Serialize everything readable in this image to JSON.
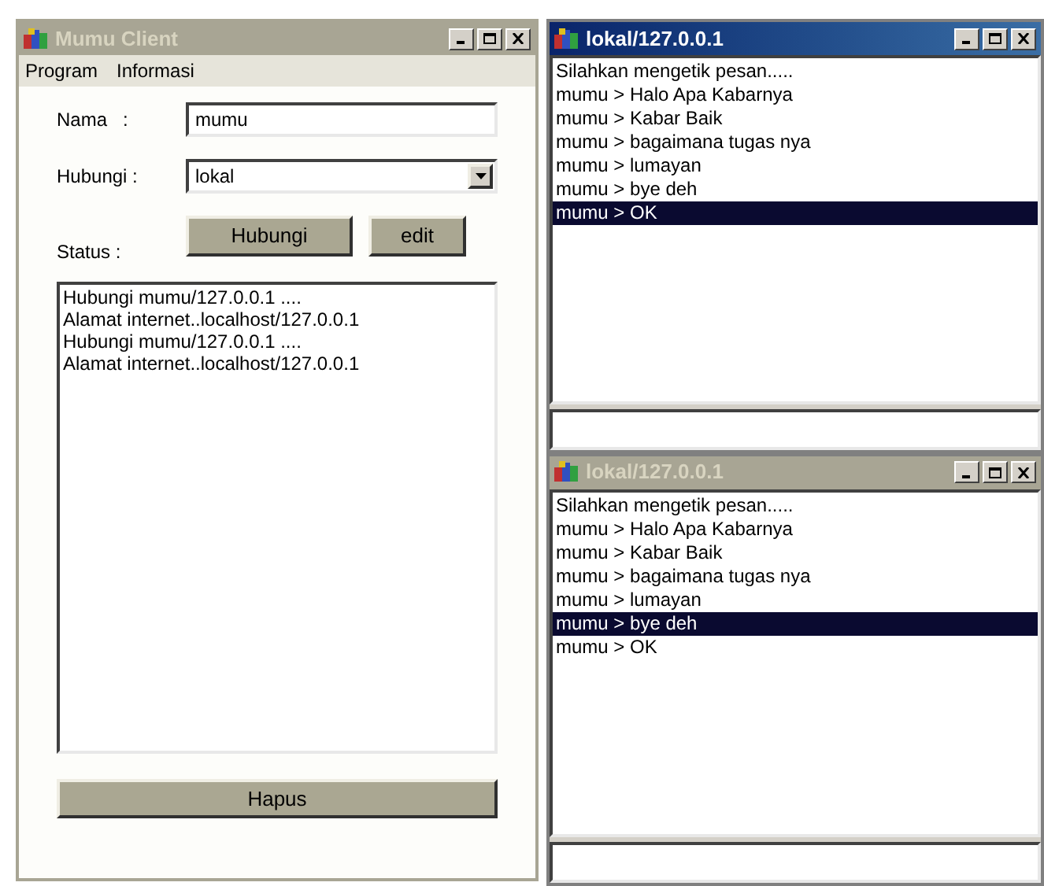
{
  "client": {
    "title": "Mumu Client",
    "active": false,
    "menu": [
      "Program",
      "Informasi"
    ],
    "name_label": "Nama   :",
    "name_value": "mumu",
    "connect_label": "Hubungi :",
    "connect_value": "lokal",
    "buttons": [
      "Hubungi",
      "edit"
    ],
    "status_label": "Status :",
    "status_lines": [
      "Hubungi mumu/127.0.0.1 ....",
      "Alamat internet..localhost/127.0.0.1",
      "Hubungi mumu/127.0.0.1 ....",
      "Alamat internet..localhost/127.0.0.1"
    ],
    "clear_button": "Hapus"
  },
  "chats": [
    {
      "title": "lokal/127.0.0.1",
      "active": true,
      "lines": [
        {
          "text": "Silahkan mengetik pesan.....",
          "selected": false
        },
        {
          "text": "mumu > Halo Apa Kabarnya",
          "selected": false
        },
        {
          "text": "mumu > Kabar Baik",
          "selected": false
        },
        {
          "text": "mumu > bagaimana tugas nya",
          "selected": false
        },
        {
          "text": "mumu > lumayan",
          "selected": false
        },
        {
          "text": "mumu > bye deh",
          "selected": false
        },
        {
          "text": "mumu > OK",
          "selected": true
        }
      ]
    },
    {
      "title": "lokal/127.0.0.1",
      "active": false,
      "lines": [
        {
          "text": "Silahkan mengetik pesan.....",
          "selected": false
        },
        {
          "text": "mumu > Halo Apa Kabarnya",
          "selected": false
        },
        {
          "text": "mumu > Kabar Baik",
          "selected": false
        },
        {
          "text": "mumu > bagaimana tugas nya",
          "selected": false
        },
        {
          "text": "mumu > lumayan",
          "selected": false
        },
        {
          "text": "mumu > bye deh",
          "selected": true
        },
        {
          "text": "mumu > OK",
          "selected": false
        }
      ]
    }
  ]
}
